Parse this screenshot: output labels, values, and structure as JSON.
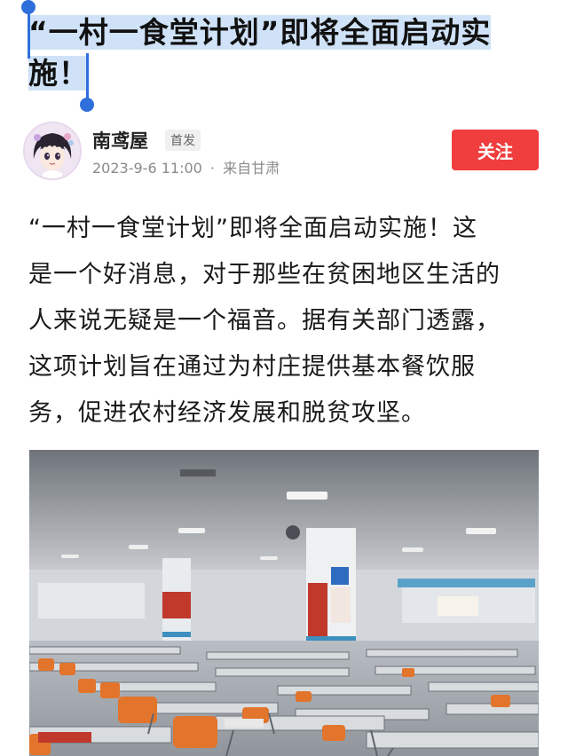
{
  "article": {
    "title_line1": "“一村一食堂计划”即将全面启动实",
    "title_line2": "施！",
    "author": "南鸢屋",
    "first_badge": "首发",
    "date": "2023-9-6 11:00",
    "separator": "·",
    "source": "来自甘肃",
    "follow_label": "关注",
    "body_line1": "“一村一食堂计划”即将全面启动实施！这",
    "body_line2": "是一个好消息，对于那些在贫困地区生活的",
    "body_line3": "人来说无疑是一个福音。据有关部门透露，",
    "body_line4": "这项计划旨在通过为村庄提供基本餐饮服",
    "body_line5": "务，促进农村经济发展和脱贫攻坚。"
  },
  "colors": {
    "selection": "#cfe2f7",
    "handle": "#2f6fdb",
    "follow_bg": "#f03d3d"
  },
  "icons": {
    "avatar": "anime-girl-avatar",
    "photo": "canteen-interior-photo"
  }
}
